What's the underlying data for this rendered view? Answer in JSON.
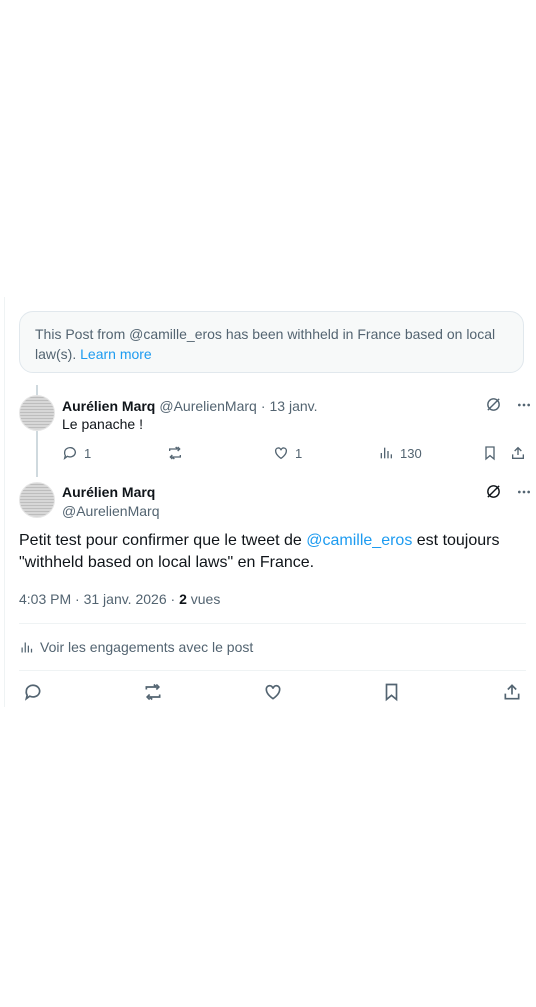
{
  "notice": {
    "text": "This Post from @camille_eros has been withheld in France based on local law(s).",
    "link": "Learn more"
  },
  "reply": {
    "name": "Aurélien Marq",
    "handle": "@AurelienMarq",
    "separator": "·",
    "date": "13 janv.",
    "text": "Le panache !",
    "replies": "1",
    "likes": "1",
    "views": "130"
  },
  "post": {
    "name": "Aurélien Marq",
    "handle": "@AurelienMarq",
    "text_before": "Petit test pour confirmer que le tweet de ",
    "mention": "@camille_eros",
    "text_after": " est toujours \"withheld based on local laws\" en France.",
    "timestamp": "4:03 PM · 31 janv. 2026 · ",
    "views_count": "2",
    "views_label": " vues",
    "engagements": "Voir les engagements avec le post"
  },
  "colors": {
    "accent": "#1d9bf0",
    "muted": "#536471",
    "text": "#0f1419"
  }
}
